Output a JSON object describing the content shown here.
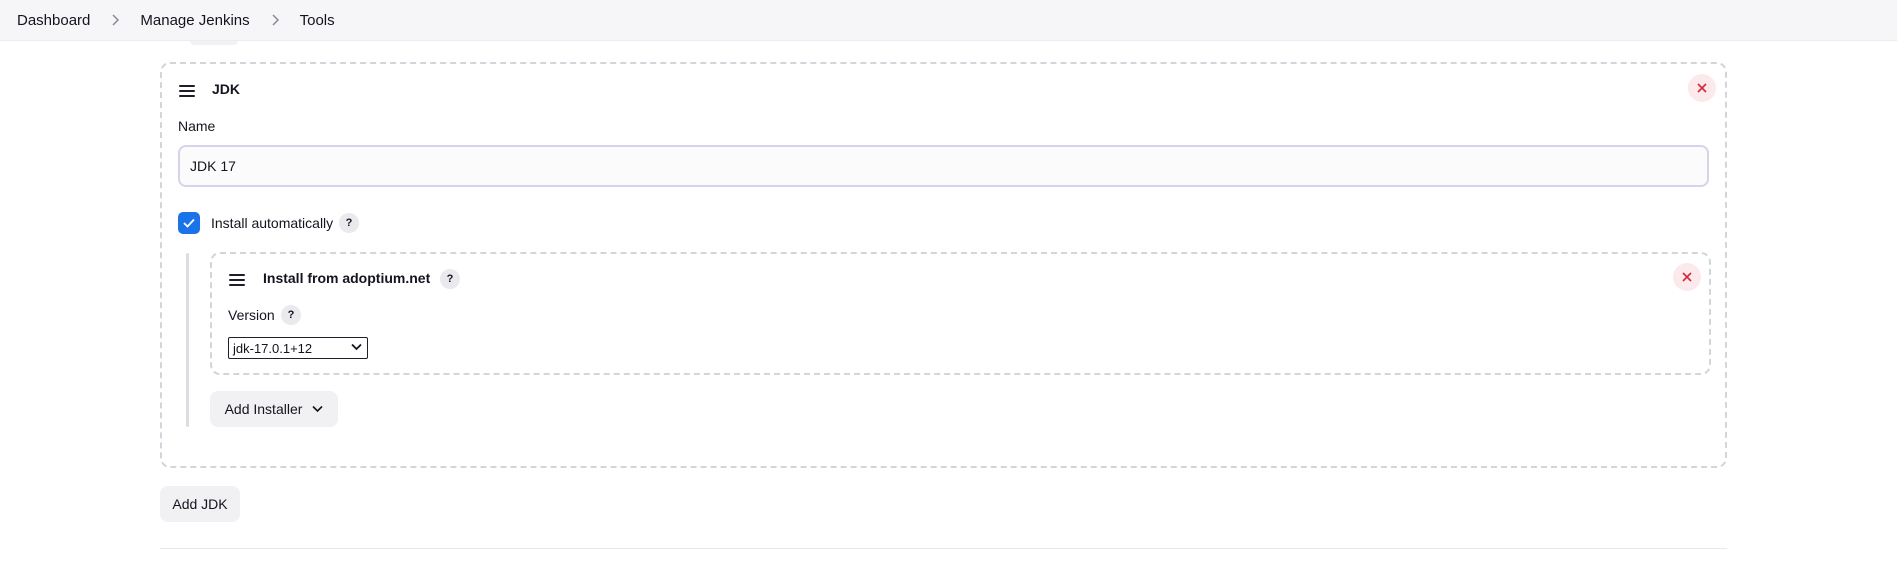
{
  "breadcrumb": {
    "items": [
      "Dashboard",
      "Manage Jenkins",
      "Tools"
    ]
  },
  "jdk_card": {
    "title": "JDK",
    "name_label": "Name",
    "name_value": "JDK 17",
    "install_auto_label": "Install automatically",
    "install_auto_checked": true,
    "help_symbol": "?"
  },
  "installer_card": {
    "title": "Install from adoptium.net",
    "version_label": "Version",
    "version_selected": "jdk-17.0.1+12"
  },
  "buttons": {
    "add_installer": "Add Installer",
    "add_jdk": "Add JDK"
  },
  "colors": {
    "accent": "#1a73e8",
    "danger": "#d3293d",
    "topbar_bg": "#f6f6f8"
  },
  "icons": [
    "chevron-right-icon",
    "drag-handle-icon",
    "close-icon",
    "checkmark-icon",
    "help-icon",
    "chevron-down-icon"
  ]
}
